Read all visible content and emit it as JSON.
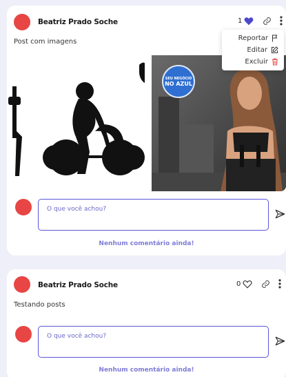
{
  "posts": [
    {
      "author": "Beatriz Prado Soche",
      "text": "Post com imagens",
      "likes": "1",
      "liked": true,
      "menu": {
        "report": "Reportar",
        "edit": "Editar",
        "delete": "Excluir"
      },
      "images": [
        {
          "icon": "weightlifting-silhouette-image"
        },
        {
          "icon": "fitness-woman-photo",
          "badge_line1": "SEU NEGÓCIO",
          "badge_line2": "NO AZUL"
        }
      ],
      "comment_placeholder": "O que você achou?",
      "no_comments": "Nenhum comentário ainda!"
    },
    {
      "author": "Beatriz Prado Soche",
      "text": "Testando posts",
      "likes": "0",
      "liked": false,
      "comment_placeholder": "O que você achou?",
      "no_comments": "Nenhum comentário ainda!"
    }
  ],
  "colors": {
    "accent": "#5a55d8",
    "heart": "#4b48c9",
    "avatar": "#e84545",
    "delete": "#e84545",
    "background": "#eeeff8"
  }
}
